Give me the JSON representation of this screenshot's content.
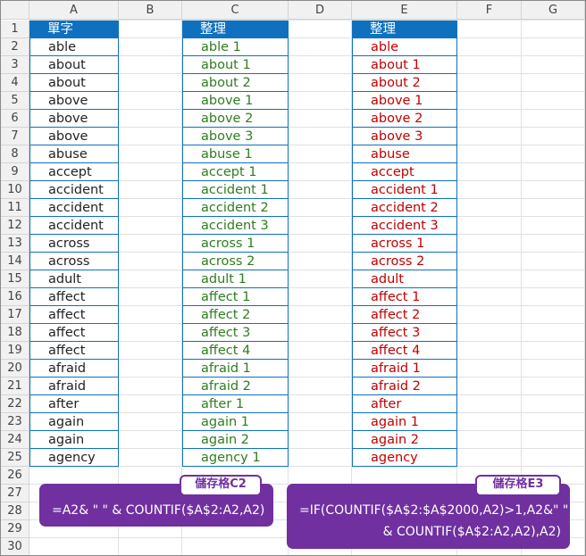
{
  "columns": [
    "A",
    "B",
    "C",
    "D",
    "E",
    "F",
    "G"
  ],
  "rows": [
    "1",
    "2",
    "3",
    "4",
    "5",
    "6",
    "7",
    "8",
    "9",
    "10",
    "11",
    "12",
    "13",
    "14",
    "15",
    "16",
    "17",
    "18",
    "19",
    "20",
    "21",
    "22",
    "23",
    "24",
    "25",
    "26",
    "27",
    "28",
    "29",
    "30"
  ],
  "headers": {
    "a": "單字",
    "c": "整理",
    "e": "整理"
  },
  "colA": [
    "able",
    "about",
    "about",
    "above",
    "above",
    "above",
    "abuse",
    "accept",
    "accident",
    "accident",
    "accident",
    "across",
    "across",
    "adult",
    "affect",
    "affect",
    "affect",
    "affect",
    "afraid",
    "afraid",
    "after",
    "again",
    "again",
    "agency"
  ],
  "colC": [
    "able 1",
    "about 1",
    "about 2",
    "above 1",
    "above 2",
    "above 3",
    "abuse 1",
    "accept 1",
    "accident 1",
    "accident 2",
    "accident 3",
    "across 1",
    "across 2",
    "adult 1",
    "affect 1",
    "affect 2",
    "affect 3",
    "affect 4",
    "afraid 1",
    "afraid 2",
    "after 1",
    "again 1",
    "again 2",
    "agency 1"
  ],
  "colE": [
    "able",
    "about 1",
    "about 2",
    "above 1",
    "above 2",
    "above 3",
    "abuse",
    "accept",
    "accident 1",
    "accident 2",
    "accident 3",
    "across 1",
    "across 2",
    "adult",
    "affect 1",
    "affect 2",
    "affect 3",
    "affect 4",
    "afraid 1",
    "afraid 2",
    "after",
    "again 1",
    "again 2",
    "agency"
  ],
  "callouts": {
    "c2": {
      "label": "儲存格C2",
      "formula": "=A2& \" \" & COUNTIF($A$2:A2,A2)"
    },
    "e3": {
      "label": "儲存格E3",
      "line1": "=IF(COUNTIF($A$2:$A$2000,A2)>1,A2&\" \"",
      "line2": "& COUNTIF($A$2:A2,A2),A2)"
    }
  },
  "colors": {
    "header_blue": "#0f70c0",
    "green_text": "#2e7d1e",
    "red_text": "#c00000",
    "callout_purple": "#7030a0"
  }
}
